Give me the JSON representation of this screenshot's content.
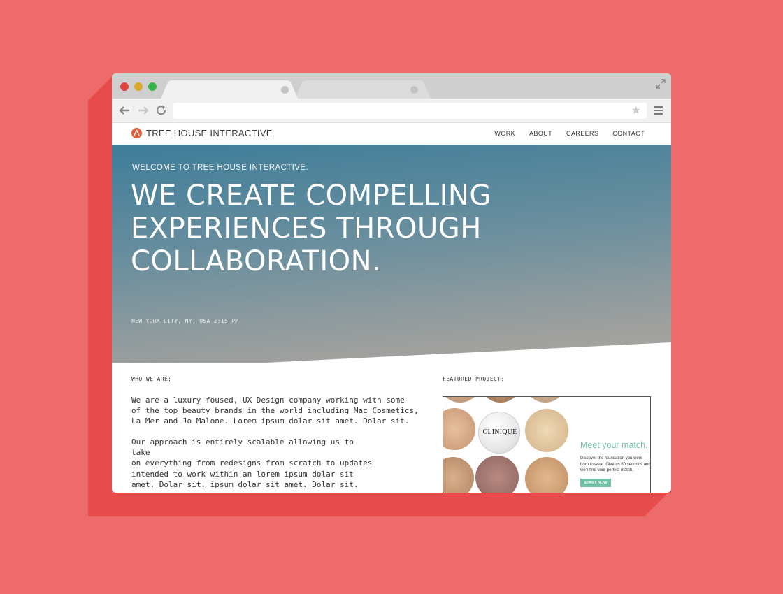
{
  "browser": {
    "url": "",
    "icons": {
      "back": "arrow-left-icon",
      "forward": "arrow-right-icon",
      "reload": "reload-icon",
      "bookmark": "star-icon",
      "menu": "hamburger-menu-icon",
      "expand": "expand-icon"
    }
  },
  "site": {
    "logo_text": "TREE HOUSE INTERACTIVE",
    "nav": [
      "WORK",
      "ABOUT",
      "CAREERS",
      "CONTACT"
    ]
  },
  "hero": {
    "welcome": "WELCOME TO TREE HOUSE INTERACTIVE.",
    "headline_lines": [
      "WE CREATE COMPELLING",
      "EXPERIENCES THROUGH",
      "COLLABORATION."
    ],
    "location": "NEW YORK CITY, NY, USA 2:15 PM"
  },
  "who": {
    "label": "WHO WE ARE:",
    "para1_lines": [
      "We are a luxury foused, UX Design company working with some",
      "of the top beauty brands in the world including Mac Cosmetics,",
      "La Mer and Jo Malone. Lorem ipsum dolar sit amet. Dolar sit."
    ],
    "para2_lines": [
      "Our approach is entirely scalable allowing us to take",
      "on everything from redesigns from scratch to updates",
      "intended to work within an lorem ipsum dolar sit",
      "amet. Dolar sit. ipsum dolar sit amet. Dolar sit."
    ]
  },
  "featured": {
    "label": "FEATURED PROJECT:",
    "brand": "CLINIQUE",
    "title": "Meet your match.",
    "description": "Discover the foundation you were born to wear. Give us 60 seconds and we'll find your perfect match.",
    "cta": "START NOW"
  },
  "colors": {
    "background": "#ed6b6a",
    "accent": "#e3603e",
    "featured_green": "#6fc0a6"
  }
}
